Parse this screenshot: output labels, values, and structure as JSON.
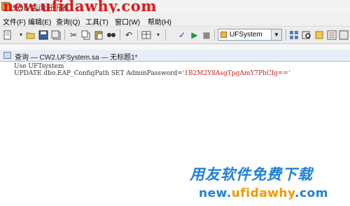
{
  "window": {
    "title": "SQL 查询分析器",
    "watermark": "new.ufidawhy.com"
  },
  "menu": {
    "items": [
      "文件(F)",
      "编辑(E)",
      "查询(Q)",
      "工具(T)",
      "窗口(W)",
      "帮助(H)"
    ]
  },
  "toolbar": {
    "database_selected": "UFSystem"
  },
  "document": {
    "tab_title": "查询 — CW2.UFSystem.sa — 无标题1*"
  },
  "editor": {
    "line1": "Use UFTsystem",
    "line2_prefix": "UPDATE dbo.EAP_ConfigPath SET AdminPassword=",
    "line2_value": "'1B2M2Y8AsgTpgAmY7PhCfg=='"
  },
  "watermark_bottom": {
    "cn": "用友软件免费下载",
    "url_a": "new.",
    "url_b": "ufidawhy",
    "url_c": ".com"
  },
  "icons": [
    "app-icon",
    "new-query-icon",
    "open-icon",
    "save-icon",
    "save-all-icon",
    "cut-icon",
    "copy-icon",
    "paste-icon",
    "find-icon",
    "undo-icon",
    "results-grid-icon",
    "check-syntax-icon",
    "execute-icon",
    "stop-icon",
    "database-icon",
    "object-browser-icon",
    "object-search-icon",
    "object-icon",
    "properties-icon"
  ]
}
